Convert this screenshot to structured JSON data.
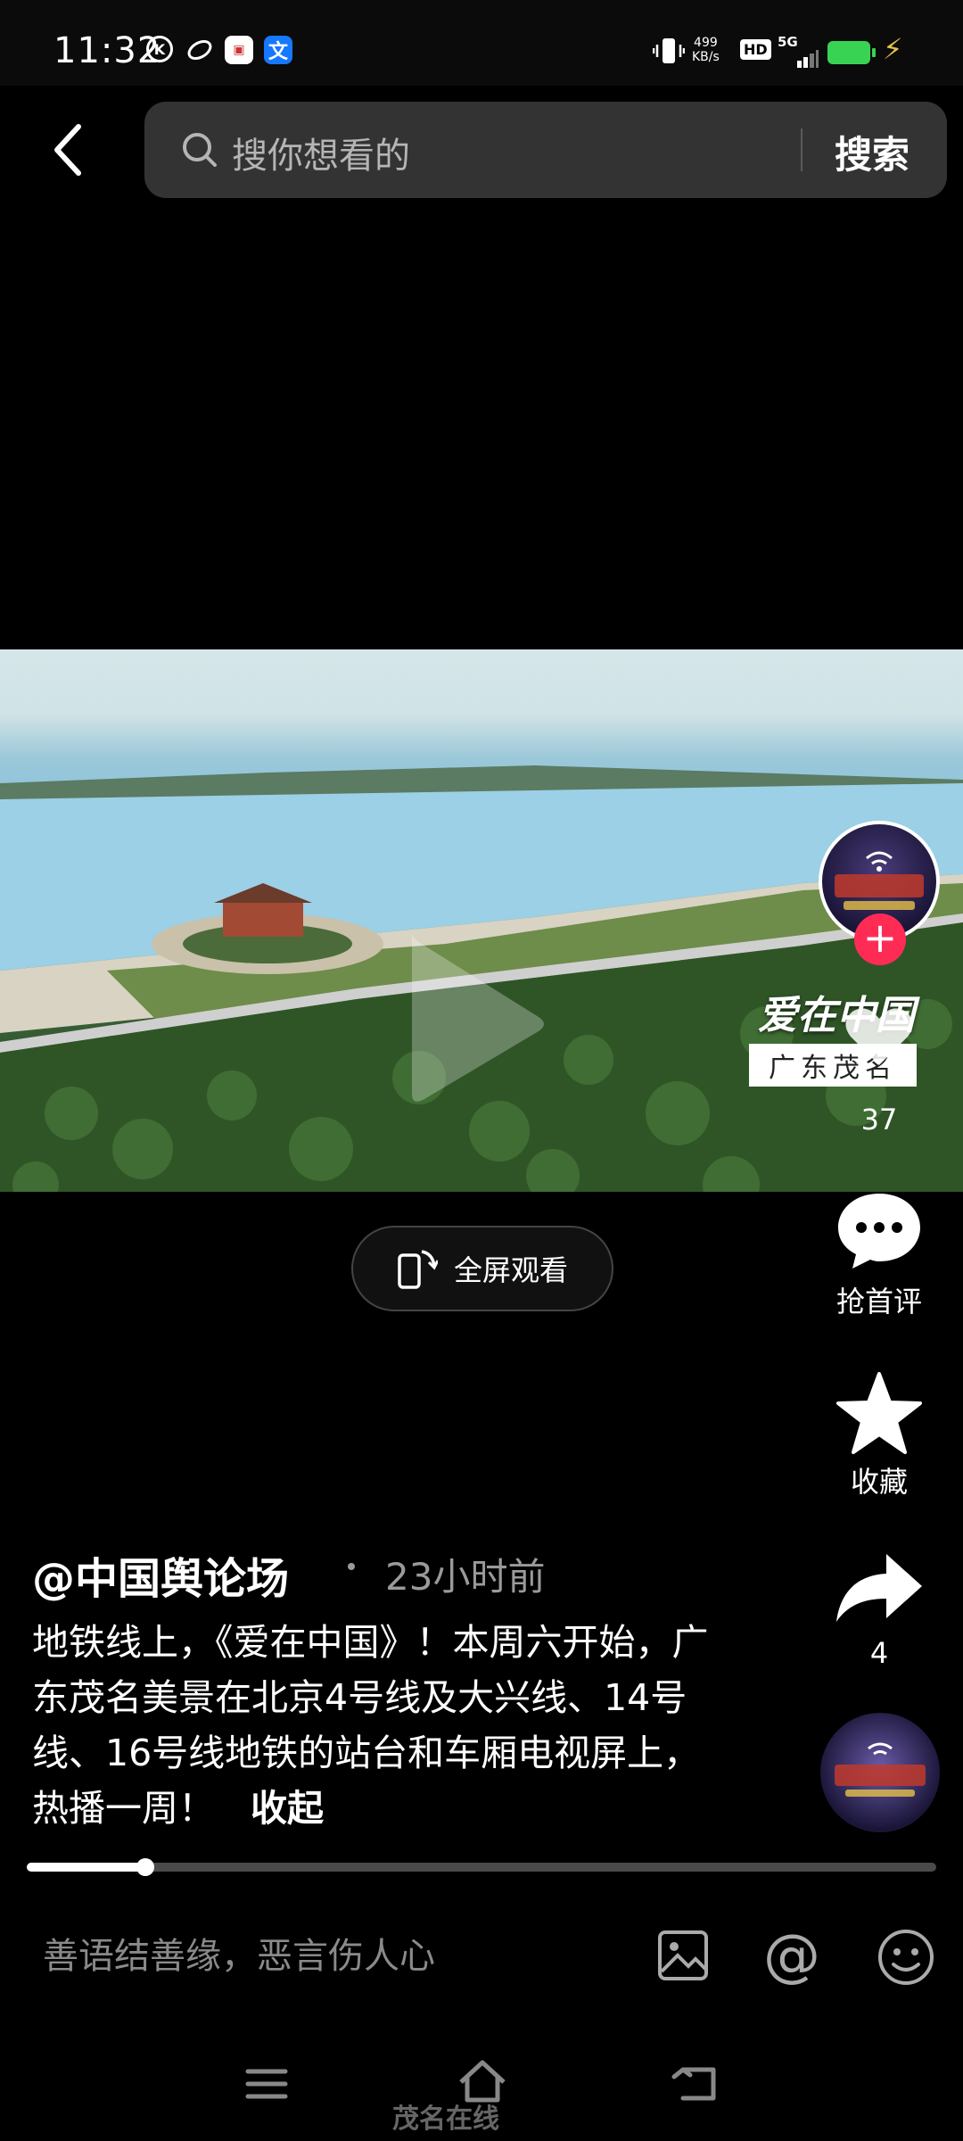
{
  "status_bar": {
    "time": "11:32",
    "net_speed_value": "499",
    "net_speed_unit": "KB/s",
    "hd_label": "HD",
    "signal_label": "5G",
    "battery_color": "#39d353"
  },
  "header": {
    "search_placeholder": "搜你想看的",
    "search_button": "搜索"
  },
  "video": {
    "watermark_title": "爱在中国",
    "watermark_subtitle": "广东茂名",
    "fullscreen_label": "全屏观看",
    "progress": 0.13
  },
  "right_rail": {
    "like_count": "37",
    "comment_label": "抢首评",
    "favorite_label": "收藏",
    "share_count": "4"
  },
  "post": {
    "author": "@中国舆论场",
    "time": "23小时前",
    "caption": "地铁线上，《爱在中国》！本周六开始，广东茂名美景在北京4号线及大兴线、14号线、16号线地铁的站台和车厢电视屏上，热播一周！",
    "collapse": "收起"
  },
  "comment_bar": {
    "placeholder": "善语结善缘，恶言伤人心"
  },
  "footer": {
    "site_logo": "茂名在线"
  },
  "colors": {
    "accent": "#fe2c55",
    "background": "#000000"
  }
}
